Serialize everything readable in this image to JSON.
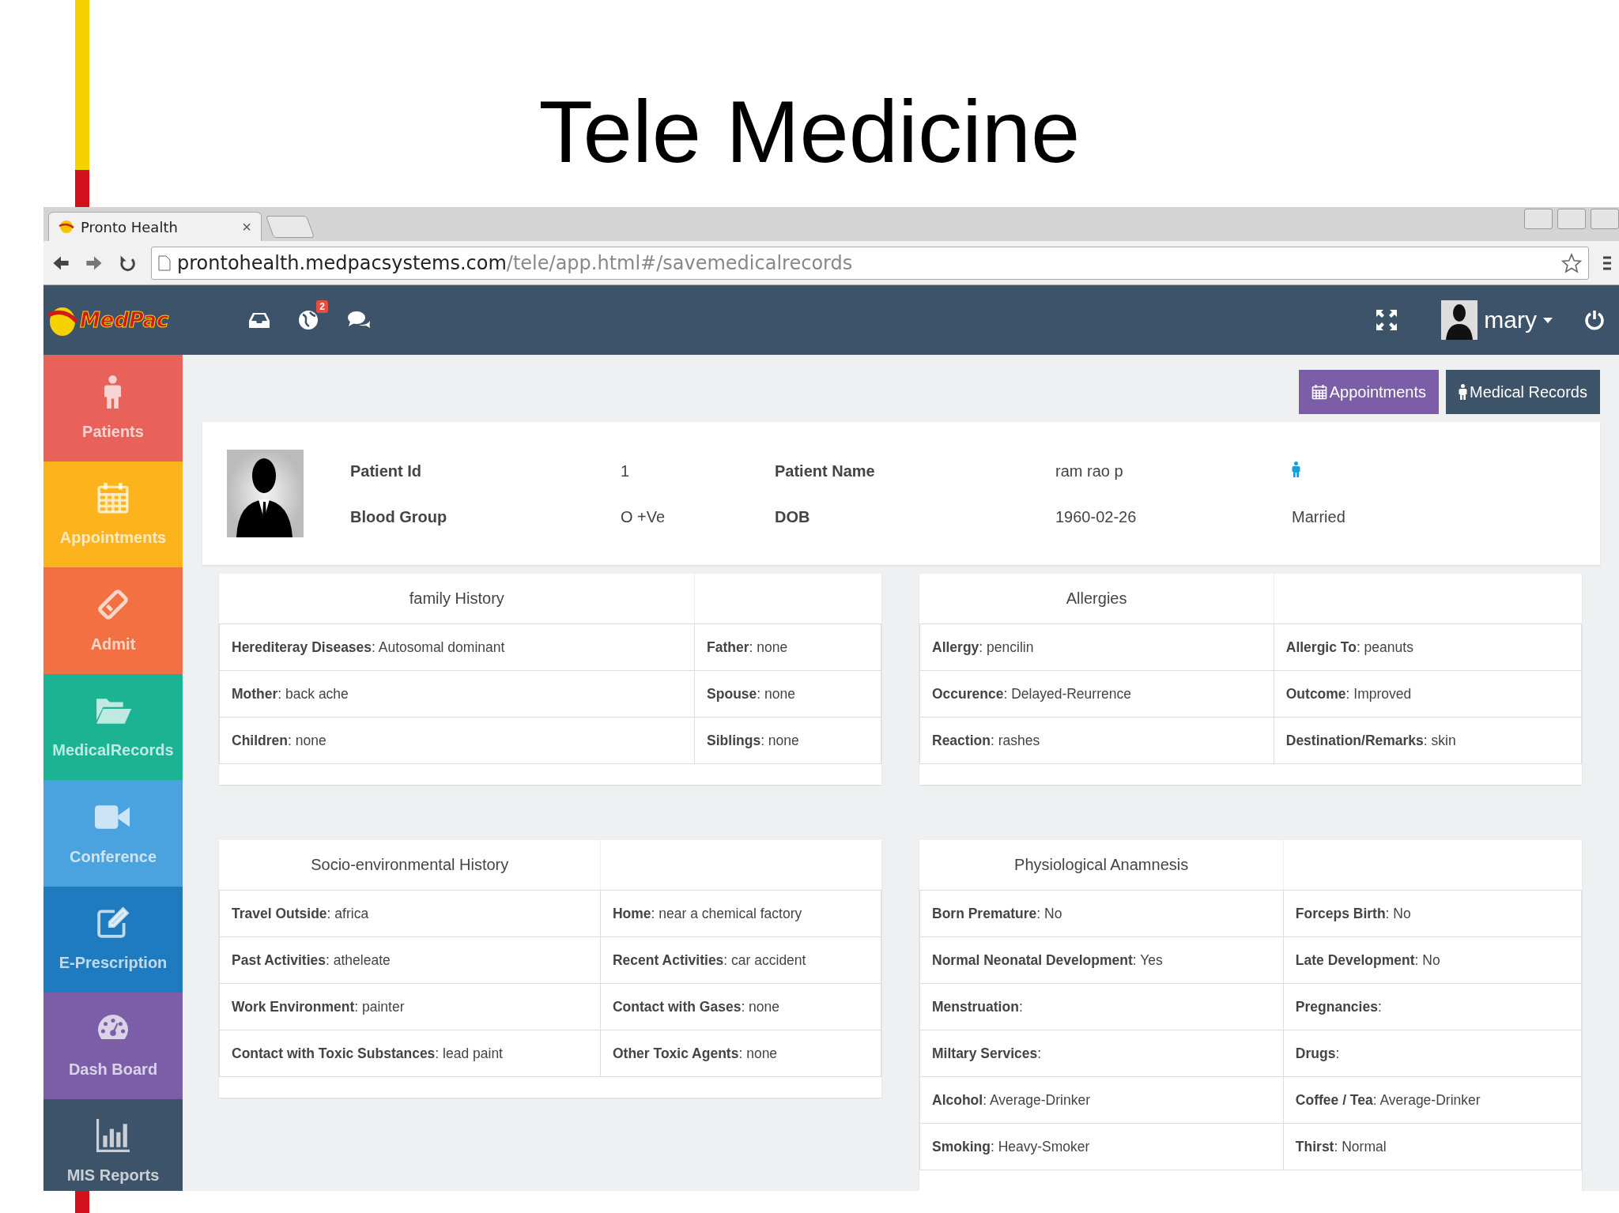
{
  "slide_title": "Tele Medicine",
  "browser": {
    "tab_title": "Pronto Health",
    "tab_close": "×",
    "url_host": "prontohealth.medpacsystems.com",
    "url_path": "/tele/app.html#/savemedicalrecords"
  },
  "navbar": {
    "brand": "MedPac",
    "notification_count": "2",
    "user_name": "mary"
  },
  "sidebar": {
    "items": [
      {
        "label": "Patients",
        "color": "#e8625a"
      },
      {
        "label": "Appointments",
        "color": "#fdb41c"
      },
      {
        "label": "Admit",
        "color": "#f37043"
      },
      {
        "label": "MedicalRecords",
        "color": "#1bb394"
      },
      {
        "label": "Conference",
        "color": "#4aa3df"
      },
      {
        "label": "E-Prescription",
        "color": "#1f7bbf"
      },
      {
        "label": "Dash Board",
        "color": "#7b5ea7"
      },
      {
        "label": "MIS Reports",
        "color": "#3d5369"
      }
    ]
  },
  "actions": [
    {
      "label": "Appointments",
      "kind": "purple"
    },
    {
      "label": "Medical Records",
      "kind": "dark"
    }
  ],
  "patient": {
    "rows": [
      [
        {
          "label": "Patient Id",
          "value": "1"
        },
        {
          "label": "Patient Name",
          "value": "ram rao p"
        },
        {
          "kind": "male-icon"
        }
      ],
      [
        {
          "label": "Blood Group",
          "value": "O +Ve"
        },
        {
          "label": "DOB",
          "value": "1960-02-26"
        },
        {
          "kind": "text",
          "text": "Married"
        }
      ]
    ]
  },
  "panels": [
    {
      "title": "family History",
      "rows": [
        [
          "**Herediteray Diseases**: Autosomal dominant",
          "**Father**: none"
        ],
        [
          "**Mother**: back ache",
          "**Spouse**: none"
        ],
        [
          "**Children**: none",
          "**Siblings**: none"
        ]
      ]
    },
    {
      "title": "Allergies",
      "rows": [
        [
          "**Allergy**: pencilin",
          "**Allergic To**: peanuts"
        ],
        [
          "**Occurence**: Delayed-Reurrence",
          "**Outcome**: Improved"
        ],
        [
          "**Reaction**: rashes",
          "**Destination/Remarks**: skin"
        ]
      ]
    },
    {
      "title": "Socio-environmental History",
      "rows": [
        [
          "**Travel Outside**: africa",
          "**Home**: near a chemical factory"
        ],
        [
          "**Past Activities**: atheleate",
          "**Recent Activities**: car accident"
        ],
        [
          "**Work Environment**: painter",
          "**Contact with Gases**: none"
        ],
        [
          "**Contact with Toxic Substances**: lead paint",
          "**Other Toxic Agents**: none"
        ]
      ]
    },
    {
      "title": "Physiological Anamnesis",
      "rows": [
        [
          "**Born Premature**: No",
          "**Forceps Birth**: No"
        ],
        [
          "**Normal Neonatal Development**: Yes",
          "**Late Development**: No"
        ],
        [
          "**Menstruation**:",
          "**Pregnancies**:"
        ],
        [
          "**Miltary Services**:",
          "**Drugs**:"
        ],
        [
          "**Alcohol**: Average-Drinker",
          "**Coffee / Tea**: Average-Drinker"
        ],
        [
          "**Smoking**: Heavy-Smoker",
          "**Thirst**: Normal"
        ]
      ]
    }
  ]
}
